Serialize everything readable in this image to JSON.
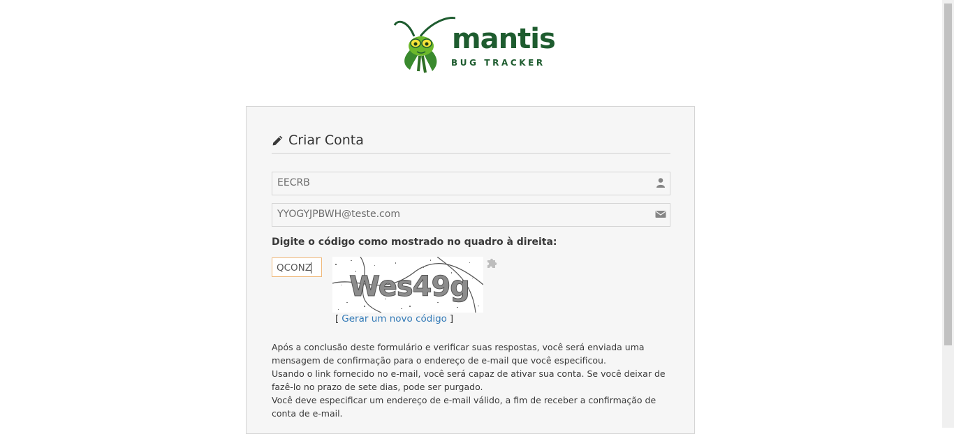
{
  "logo": {
    "name": "mantis",
    "subtitle": "BUG TRACKER"
  },
  "form": {
    "title": "Criar Conta",
    "username_value": "EECRB",
    "email_value": "YYOGYJPBWH@teste.com",
    "captcha_label": "Digite o código como mostrado no quadro à direita:",
    "captcha_input_value": "QCONZ",
    "captcha_image_text": "Wes49g",
    "regenerate_open": "[",
    "regenerate_link": "Gerar um novo código",
    "regenerate_close": "]",
    "info_lines": [
      "Após a conclusão deste formulário e verificar suas respostas, você será enviada uma mensagem de confirmação para o endereço de e-mail que você especificou.",
      "Usando o link fornecido no e-mail, você será capaz de ativar sua conta. Se você deixar de fazê-lo no prazo de sete dias, pode ser purgado.",
      "Você deve especificar um endereço de e-mail válido, a fim de receber a confirmação de conta de e-mail."
    ]
  },
  "icons": {
    "title": "pencil-icon",
    "username": "user-icon",
    "email": "envelope-icon",
    "captcha_refresh": "puzzle-icon"
  },
  "colors": {
    "brand_green": "#1e5c2f",
    "link": "#337ab7",
    "focus_border": "#f0b97a"
  }
}
